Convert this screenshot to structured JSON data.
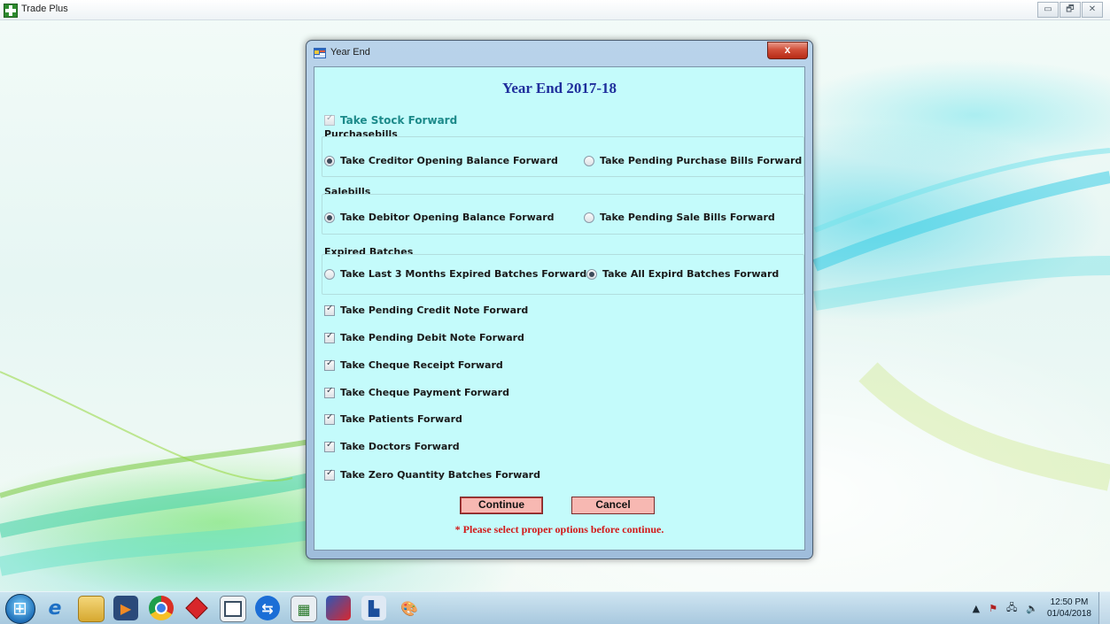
{
  "app": {
    "title": "Trade Plus",
    "window_controls": [
      "▭",
      "🗗",
      "✕"
    ]
  },
  "dialog": {
    "title": "Year End",
    "close_label": "x",
    "heading": "Year End 2017-18",
    "take_stock": {
      "label": "Take Stock Forward",
      "checked": true,
      "disabled": true
    },
    "purchase": {
      "label": "Purchasebills",
      "options": [
        {
          "label": "Take Creditor Opening Balance Forward",
          "selected": true
        },
        {
          "label": "Take Pending Purchase Bills Forward",
          "selected": false
        }
      ]
    },
    "sale": {
      "label": "Salebills",
      "options": [
        {
          "label": "Take Debitor Opening Balance Forward",
          "selected": true
        },
        {
          "label": "Take Pending Sale Bills Forward",
          "selected": false
        }
      ]
    },
    "expired": {
      "label": "Expired Batches",
      "options": [
        {
          "label": "Take Last 3 Months Expired Batches Forward",
          "selected": false
        },
        {
          "label": "Take All Expird Batches Forward",
          "selected": true
        }
      ]
    },
    "checks": [
      {
        "label": "Take Pending Credit Note Forward",
        "checked": true
      },
      {
        "label": "Take Pending Debit Note Forward",
        "checked": true
      },
      {
        "label": "Take Cheque Receipt Forward",
        "checked": true
      },
      {
        "label": "Take Cheque Payment Forward",
        "checked": true
      },
      {
        "label": "Take Patients Forward",
        "checked": true
      },
      {
        "label": "Take Doctors Forward",
        "checked": true
      },
      {
        "label": "Take Zero Quantity Batches Forward",
        "checked": true
      }
    ],
    "buttons": {
      "continue": "Continue",
      "cancel": "Cancel"
    },
    "note": "* Please select proper options before continue.",
    "colors": {
      "heading": "#1f2f9c",
      "note": "#d21919",
      "take_stock": "#1c8a8a",
      "client_bg": "#c4fbfb",
      "button_bg": "#f7b8b2"
    }
  },
  "taskbar": {
    "icons": [
      "start-orb-icon",
      "internet-explorer-icon",
      "file-explorer-icon",
      "media-player-icon",
      "chrome-icon",
      "red-diamond-app-icon",
      "window-app-icon",
      "teamviewer-icon",
      "calculator-app-icon",
      "paint-brush-app-icon",
      "network-app-icon",
      "paint-palette-icon"
    ],
    "clock_time": "12:50 PM",
    "clock_date": "01/04/2018",
    "tray_arrow": "▲"
  }
}
